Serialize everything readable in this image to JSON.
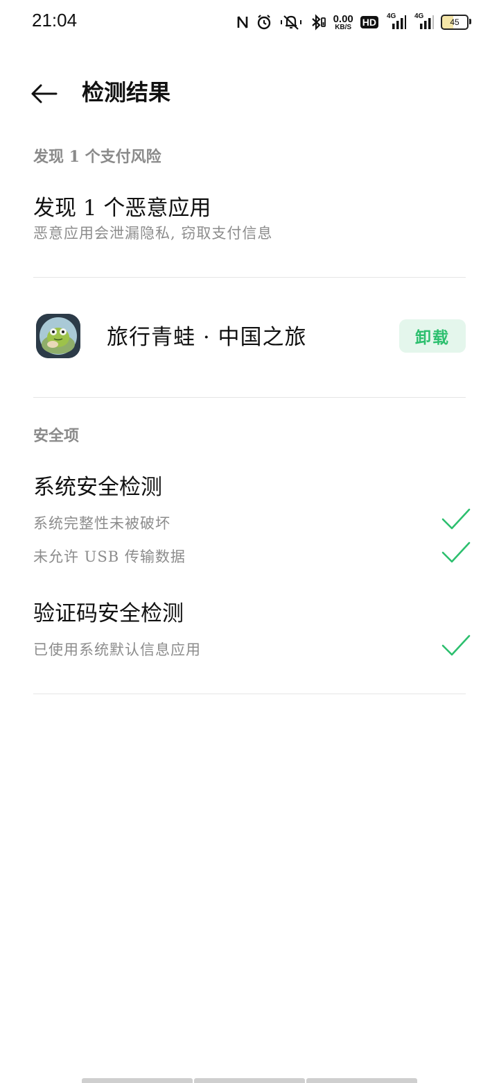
{
  "status_bar": {
    "time": "21:04",
    "net_speed_value": "0.00",
    "net_speed_unit": "KB/S",
    "hd_label": "HD",
    "signal1_label": "4G",
    "signal2_label": "4G",
    "battery_level": "45",
    "icons": [
      "nfc-icon",
      "alarm-icon",
      "vibrate-icon",
      "bluetooth-icon"
    ]
  },
  "header": {
    "title": "检测结果"
  },
  "payment_risk": {
    "section_label": "发现 1 个支付风险",
    "heading": "发现 1 个恶意应用",
    "description": "恶意应用会泄漏隐私, 窃取支付信息",
    "app": {
      "name": "旅行青蛙 · 中国之旅",
      "uninstall_label": "卸载"
    }
  },
  "safety": {
    "section_label": "安全项",
    "groups": [
      {
        "heading": "系统安全检测",
        "items": [
          "系统完整性未被破坏",
          "未允许 USB 传输数据"
        ]
      },
      {
        "heading": "验证码安全检测",
        "items": [
          "已使用系统默认信息应用"
        ]
      }
    ]
  },
  "colors": {
    "accent_green": "#2cbf6e",
    "uninstall_bg": "#e4f6ec",
    "secondary_text": "#8c8c8c"
  }
}
